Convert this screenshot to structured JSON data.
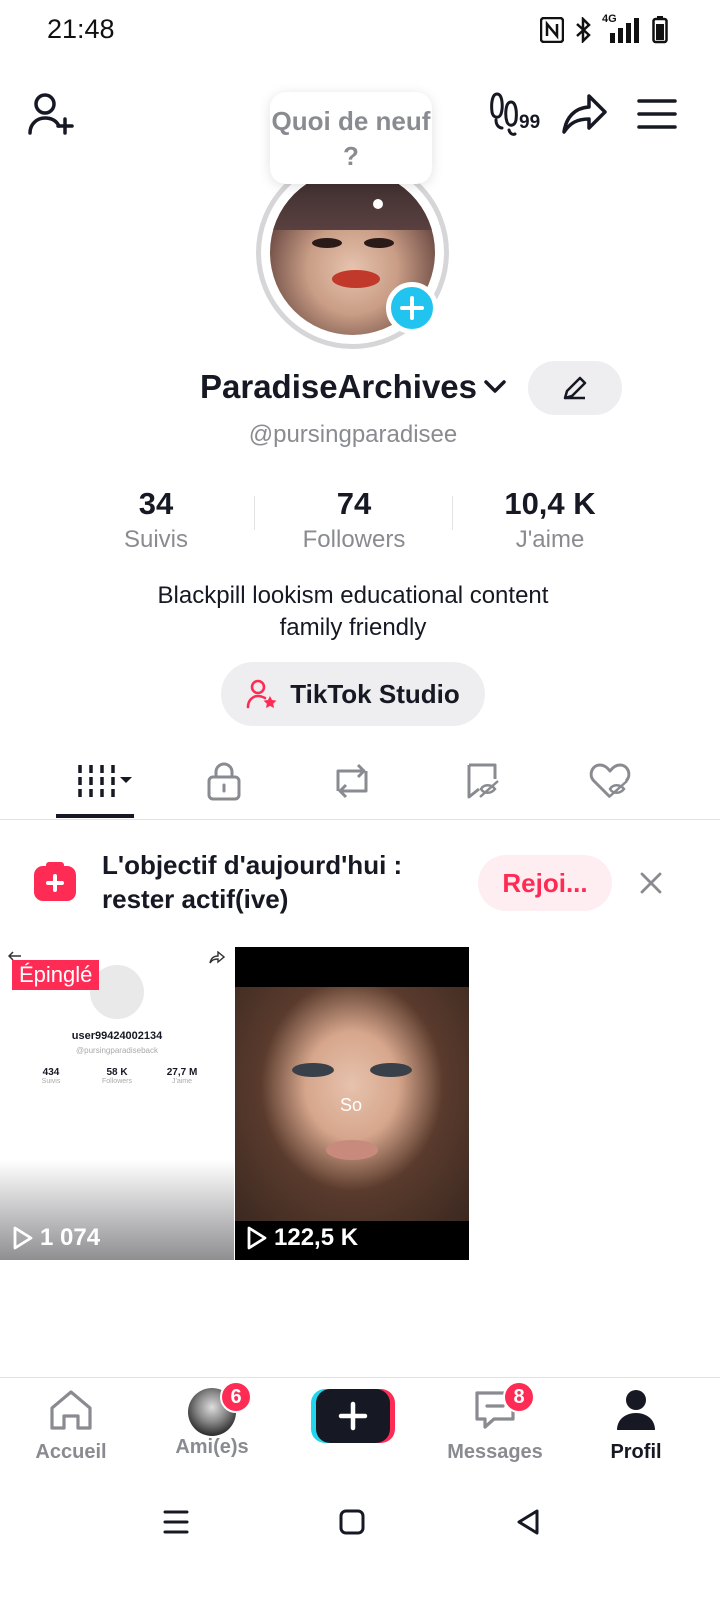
{
  "status_bar": {
    "time": "21:48",
    "network": "4G",
    "icons": [
      "nfc-icon",
      "bluetooth-icon",
      "signal-icon",
      "battery-icon"
    ]
  },
  "header": {
    "add_friend_icon": "person-plus-icon",
    "footprints_count": "99",
    "share_icon": "share-icon",
    "menu_icon": "hamburger-icon"
  },
  "bubble": {
    "text": "Quoi de neuf ?"
  },
  "profile": {
    "username": "ParadiseArchives",
    "handle": "@pursingparadisee",
    "stats": [
      {
        "value": "34",
        "label": "Suivis"
      },
      {
        "value": "74",
        "label": "Followers"
      },
      {
        "value": "10,4 K",
        "label": "J'aime"
      }
    ],
    "bio_line1": "Blackpill lookism educational content",
    "bio_line2": "family friendly",
    "studio_label": "TikTok Studio"
  },
  "tabs": [
    "videos-grid",
    "private",
    "reposts",
    "favorites",
    "liked"
  ],
  "goal": {
    "line1": "L'objectif d'aujourd'hui :",
    "line2": "rester actif(ive)",
    "join_label": "Rejoi..."
  },
  "videos": [
    {
      "pinned_label": "Épinglé",
      "views": "1 074",
      "mini": {
        "user": "user99424002134",
        "handle": "@pursingparadiseback",
        "stats": [
          {
            "value": "434",
            "label": "Suivis"
          },
          {
            "value": "58 K",
            "label": "Followers"
          },
          {
            "value": "27,7 M",
            "label": "J'aime"
          }
        ]
      }
    },
    {
      "caption": "So",
      "views": "122,5 K"
    }
  ],
  "bottom_nav": {
    "items": [
      {
        "label": "Accueil"
      },
      {
        "label": "Ami(e)s",
        "badge": "6"
      },
      {
        "label": ""
      },
      {
        "label": "Messages",
        "badge": "8"
      },
      {
        "label": "Profil"
      }
    ]
  },
  "colors": {
    "accent": "#fe2c55",
    "cyan": "#20c4ef",
    "text": "#161823",
    "muted": "#8a8b91"
  }
}
